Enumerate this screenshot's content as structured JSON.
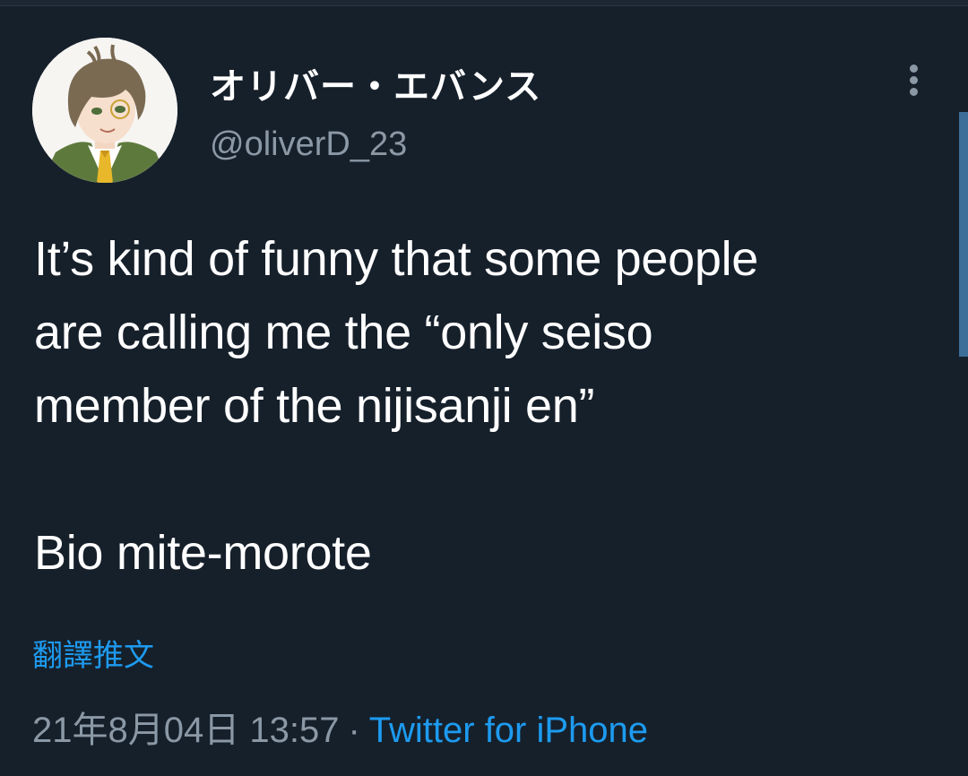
{
  "tweet": {
    "author": {
      "display_name": "オリバー・エバンス",
      "handle": "@oliverD_23"
    },
    "text": "It’s kind of funny that some people\nare calling me the “only seiso\nmember of the nijisanji en”\n\nBio mite-morote",
    "translate_label": "翻譯推文",
    "timestamp": "21年8月04日 13:57",
    "separator": "·",
    "source": "Twitter for iPhone"
  },
  "icons": {
    "more": "more-vertical-icon",
    "avatar": "profile-avatar"
  },
  "colors": {
    "background": "#16202b",
    "link": "#1d9bf0",
    "secondary_text": "#8b98a5",
    "primary_text": "#ffffff"
  }
}
